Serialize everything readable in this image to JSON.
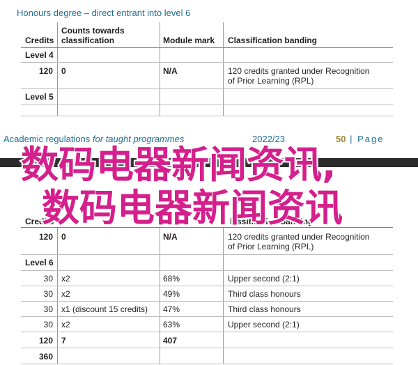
{
  "section_title": "Honours degree – direct entrant into level 6",
  "headers": {
    "credits": "Credits",
    "counts_line1": "Counts towards",
    "counts_line2": "classification",
    "module_mark": "Module mark",
    "banding": "Classification banding"
  },
  "table1": {
    "level4_label": "Level 4",
    "row1": {
      "credits": "120",
      "counts": "0",
      "mark": "N/A",
      "banding_line1": "120 credits granted under Recognition",
      "banding_line2": "of Prior Learning (RPL)"
    },
    "level5_label": "Level 5"
  },
  "footer": {
    "title_main": "Academic regulations",
    "title_italic": " for taught programmes",
    "year": "2022/23",
    "page_number": "50",
    "page_sep": " | ",
    "page_word": "Page"
  },
  "overlay": {
    "line1": "数码电器新闻资讯,",
    "line2": "数码电器新闻资讯"
  },
  "table2": {
    "partial_credits": "Credits",
    "partial_banding": "lassification banding",
    "row1": {
      "credits": "120",
      "counts": "0",
      "mark": "N/A",
      "banding_line1": "120 credits granted under Recognition",
      "banding_line2": "of Prior Learning (RPL)"
    },
    "level6_label": "Level 6",
    "rows": [
      {
        "credits": "30",
        "counts": "x2",
        "mark": "68%",
        "banding": "Upper second (2:1)"
      },
      {
        "credits": "30",
        "counts": "x2",
        "mark": "49%",
        "banding": "Third class honours"
      },
      {
        "credits": "30",
        "counts": "x1 (discount 15 credits)",
        "mark": "47%",
        "banding": "Third class honours"
      },
      {
        "credits": "30",
        "counts": "x2",
        "mark": "63%",
        "banding": "Upper second (2:1)"
      }
    ],
    "total": {
      "credits": "120",
      "counts": "7",
      "mark": "407"
    },
    "grand_total": {
      "credits": "360"
    }
  },
  "colors": {
    "heading_blue": "#1f6f93",
    "page_gold": "#9b8b33",
    "overlay_magenta": "#d41f8c"
  }
}
